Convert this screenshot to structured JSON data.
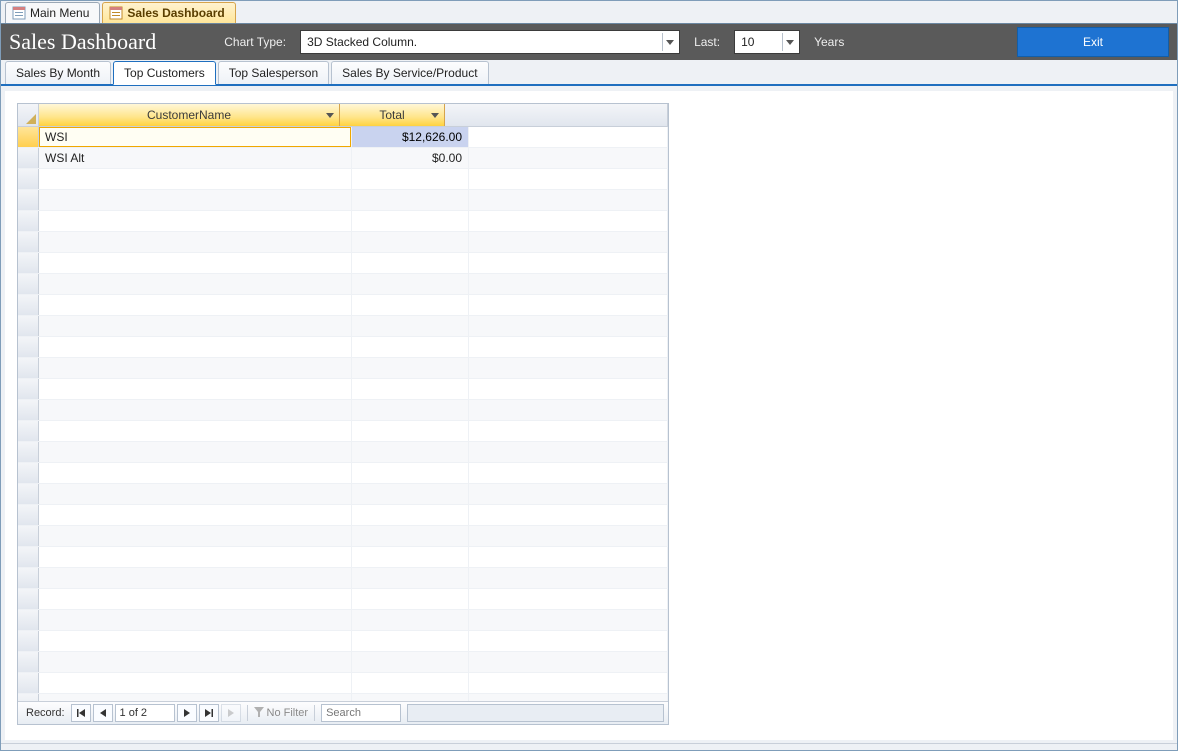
{
  "doc_tabs": {
    "main_menu": "Main Menu",
    "sales_dashboard": "Sales Dashboard"
  },
  "header": {
    "title": "Sales Dashboard",
    "chart_type_label": "Chart Type:",
    "chart_type_value": "3D Stacked Column.",
    "last_label": "Last:",
    "last_value": "10",
    "years_label": "Years",
    "exit_label": "Exit"
  },
  "page_tabs": {
    "sales_by_month": "Sales By Month",
    "top_customers": "Top Customers",
    "top_salesperson": "Top Salesperson",
    "sales_by_service": "Sales By Service/Product"
  },
  "grid": {
    "columns": {
      "name": "CustomerName",
      "total": "Total"
    },
    "rows": [
      {
        "name": "WSI",
        "total": "$12,626.00"
      },
      {
        "name": "WSI Alt",
        "total": "$0.00"
      }
    ]
  },
  "recnav": {
    "label": "Record:",
    "position": "1 of 2",
    "nofilter": "No Filter",
    "search": "Search"
  }
}
